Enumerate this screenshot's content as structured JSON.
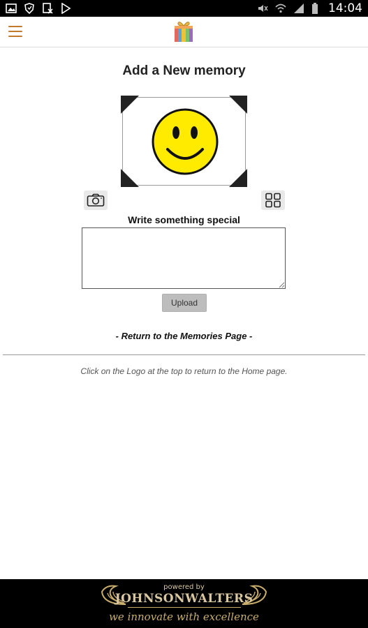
{
  "status_bar": {
    "time": "14:04",
    "left_icons": [
      "image-icon",
      "shield-icon",
      "file-x-icon",
      "play-store-icon"
    ],
    "right_icons": [
      "mute-icon",
      "wifi-icon",
      "signal-icon",
      "battery-icon"
    ]
  },
  "header": {
    "menu_icon": "hamburger-icon",
    "logo_icon": "gift-box-logo-icon",
    "accent_color": "#c07a2a"
  },
  "main": {
    "title": "Add a New memory",
    "photo_placeholder_icon": "smiley-face-icon",
    "camera_icon": "camera-icon",
    "gallery_icon": "grid-icon",
    "write_label": "Write something special",
    "memory_value": "",
    "upload_label": "Upload",
    "return_link": "- Return to the Memories Page -",
    "hint": "Click on the Logo at the top to return to the Home page."
  },
  "footer": {
    "powered_by": "powered by",
    "brand": "JOHNSONWALTERS",
    "tagline": "we innovate with excellence",
    "brand_color": "#c9ad6d"
  }
}
